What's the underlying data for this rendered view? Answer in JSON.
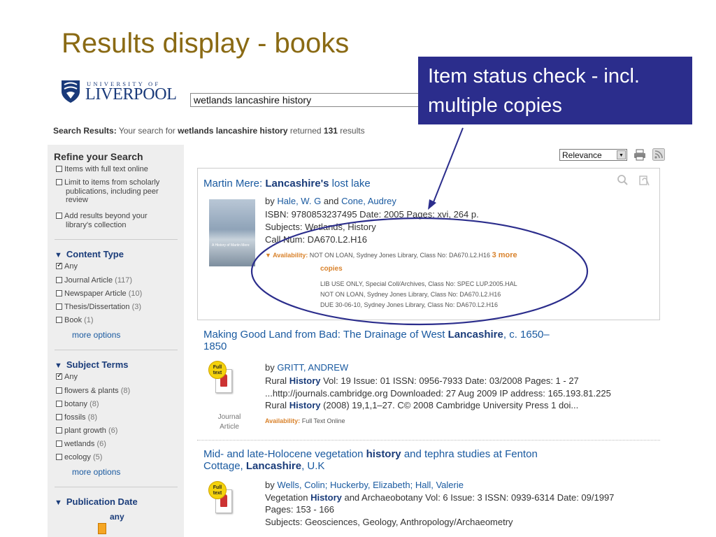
{
  "slide": {
    "title": "Results display - books"
  },
  "header": {
    "logo_top": "UNIVERSITY OF",
    "logo_main": "LIVERPOOL",
    "search_value": "wetlands lancashire history"
  },
  "callout": {
    "text": "Item status check - incl. multiple copies"
  },
  "summary": {
    "label": "Search Results:",
    "prefix": "Your search for",
    "query": "wetlands lancashire history",
    "middle": "returned",
    "count": "131",
    "suffix": "results"
  },
  "sidebar": {
    "refine_title": "Refine your Search",
    "refine_items": [
      "Items with full text online",
      "Limit to items from scholarly",
      "publications, including peer",
      "review",
      "Add results beyond your",
      "library's collection"
    ],
    "content_type": {
      "title": "Content Type",
      "items": [
        {
          "label": "Any",
          "count": ""
        },
        {
          "label": "Journal Article",
          "count": "(117)"
        },
        {
          "label": "Newspaper Article",
          "count": "(10)"
        },
        {
          "label": "Thesis/Dissertation",
          "count": "(3)"
        },
        {
          "label": "Book",
          "count": "(1)"
        }
      ],
      "more": "more options"
    },
    "subject_terms": {
      "title": "Subject Terms",
      "items": [
        {
          "label": "Any",
          "count": ""
        },
        {
          "label": "flowers & plants",
          "count": "(8)"
        },
        {
          "label": "botany",
          "count": "(8)"
        },
        {
          "label": "fossils",
          "count": "(8)"
        },
        {
          "label": "plant growth",
          "count": "(6)"
        },
        {
          "label": "wetlands",
          "count": "(6)"
        },
        {
          "label": "ecology",
          "count": "(5)"
        }
      ],
      "more": "more options"
    },
    "publication_date": {
      "title": "Publication Date",
      "any": "any"
    }
  },
  "toolbar": {
    "sort_value": "Relevance"
  },
  "results": [
    {
      "title_pre": "Martin Mere: ",
      "title_bold": "Lancashire's",
      "title_post": " lost lake",
      "by_prefix": "by ",
      "author1": "Hale, W. G",
      "and": " and ",
      "author2": "Cone, Audrey",
      "isbn": "ISBN: 9780853237495 Date: 2005 Pages: xvi, 264 p.",
      "subjects": "Subjects: Wetlands, History",
      "callnum": "Call Num: DA670.L2.H16",
      "availability_label": "▼ Availability:",
      "availability_main": "NOT ON LOAN, Sydney Jones Library, Class No: DA670.L2.H16",
      "more_copies": "3 more",
      "copies_word": "copies",
      "copies": [
        "LIB USE ONLY, Special Coll/Archives, Class No: SPEC LUP.2005.HAL",
        "NOT ON LOAN, Sydney Jones Library, Class No: DA670.L2.H16",
        "DUE 30-06-10, Sydney Jones Library, Class No: DA670.L2.H16"
      ],
      "cover_text": "A History of Martin Mere"
    },
    {
      "title_pre": "Making Good Land from Bad: The Drainage of West ",
      "title_bold": "Lancashire",
      "title_post": ", c. 1650–",
      "title_line2": "1850",
      "by_prefix": "by ",
      "author1": "GRITT, ANDREW",
      "line1_pre": "Rural ",
      "line1_bold": "History",
      "line1_post": " Vol: 19 Issue: 01 ISSN: 0956-7933 Date: 03/2008 Pages: 1 - 27",
      "line2": "...http://journals.cambridge.org Downloaded: 27 Aug 2009 IP address: 165.193.81.225",
      "line3_pre": "Rural ",
      "line3_bold": "History",
      "line3_post": " (2008) 19,1,1–27. C© 2008 Cambridge University Press 1 doi...",
      "availability_label": "Availability:",
      "availability_main": "Full Text Online",
      "badge": "Full text",
      "type_label": "Journal Article"
    },
    {
      "title_pre": "Mid- and late-Holocene vegetation ",
      "title_bold": "history",
      "title_post": " and tephra studies at Fenton",
      "title_line2_pre": "Cottage, ",
      "title_line2_bold": "Lancashire",
      "title_line2_post": ", U.K",
      "by_prefix": "by ",
      "authors": "Wells, Colin; Huckerby, Elizabeth; Hall, Valerie",
      "line1_pre": "Vegetation ",
      "line1_bold": "History",
      "line1_post": " and Archaeobotany Vol: 6 Issue: 3 ISSN: 0939-6314 Date: 09/1997",
      "line2": "Pages: 153 - 166",
      "line3": "Subjects: Geosciences, Geology, Anthropology/Archaeometry",
      "badge": "Full text"
    }
  ],
  "colors": {
    "title_gold": "#8a6a14",
    "callout_bg": "#2b2d8c",
    "link_blue": "#1a5aa0",
    "availability_orange": "#d9822b"
  }
}
